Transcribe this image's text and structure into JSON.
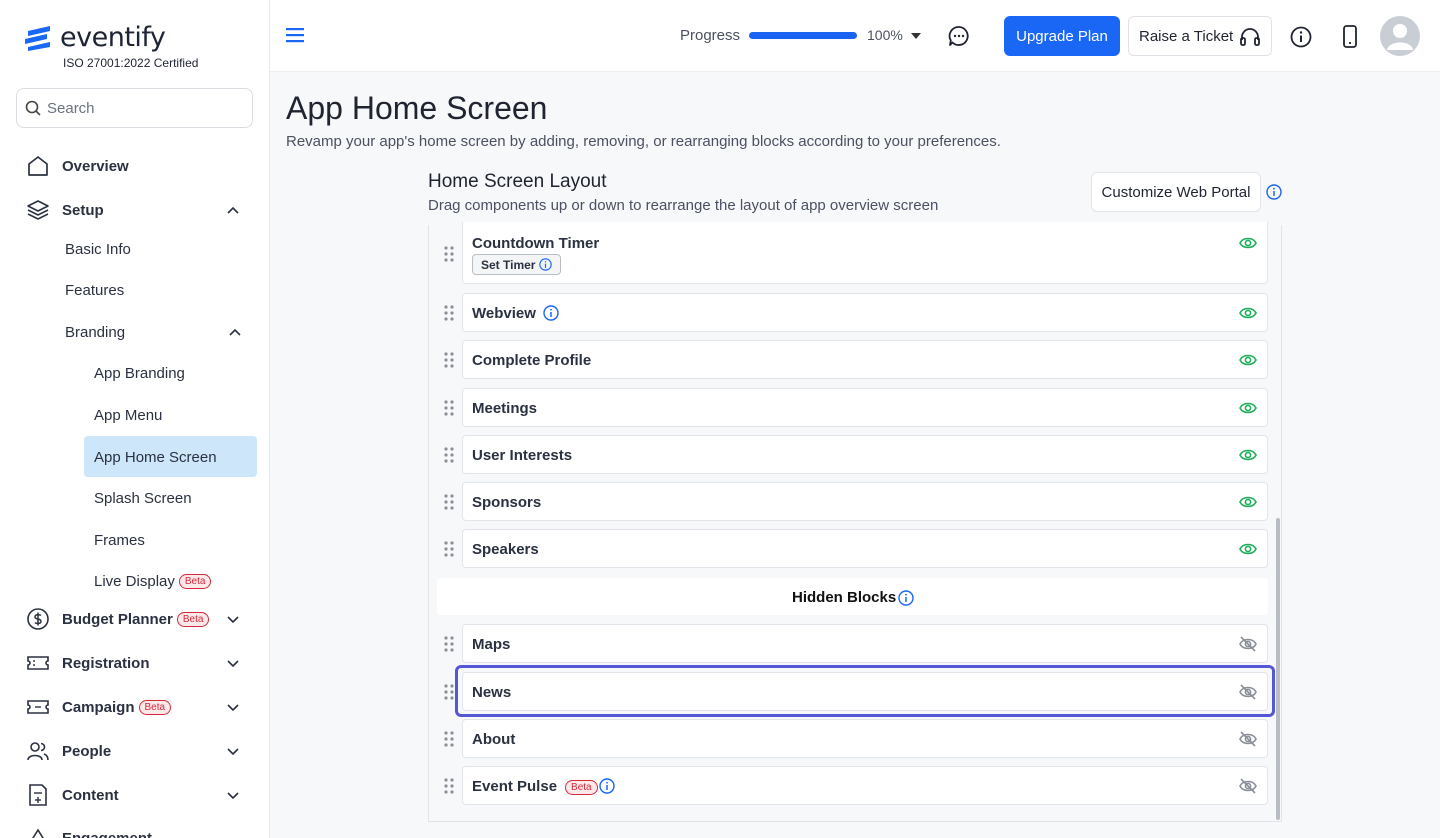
{
  "brand": {
    "name": "eventify",
    "certification": "ISO 27001:2022 Certified",
    "accent": "#1a66f5"
  },
  "search": {
    "placeholder": "Search"
  },
  "sidebar": {
    "overview": "Overview",
    "setup": "Setup",
    "setup_items": {
      "basic_info": "Basic Info",
      "features": "Features",
      "branding": "Branding"
    },
    "branding_items": {
      "app_branding": "App Branding",
      "app_menu": "App Menu",
      "app_home_screen": "App Home Screen",
      "splash_screen": "Splash Screen",
      "frames": "Frames",
      "live_display": "Live Display"
    },
    "budget_planner": "Budget Planner",
    "registration": "Registration",
    "campaign": "Campaign",
    "people": "People",
    "content": "Content",
    "engagement": "Engagement",
    "beta_badge": "Beta"
  },
  "header": {
    "progress_label": "Progress",
    "progress_value": "100%",
    "progress_fraction": 1.0,
    "upgrade_label": "Upgrade Plan",
    "ticket_label": "Raise a Ticket"
  },
  "page": {
    "title": "App Home Screen",
    "subtitle": "Revamp your app's home screen by adding, removing, or rearranging blocks according to your preferences."
  },
  "layout": {
    "title": "Home Screen Layout",
    "subtitle": "Drag components up or down to rearrange the layout of app overview screen",
    "customize_label": "Customize Web Portal",
    "set_timer_label": "Set Timer",
    "visible_blocks": [
      "Countdown Timer",
      "Webview",
      "Complete Profile",
      "Meetings",
      "User Interests",
      "Sponsors",
      "Speakers"
    ],
    "hidden_title": "Hidden Blocks",
    "hidden_blocks": [
      "Maps",
      "News",
      "About",
      "Event Pulse"
    ]
  }
}
